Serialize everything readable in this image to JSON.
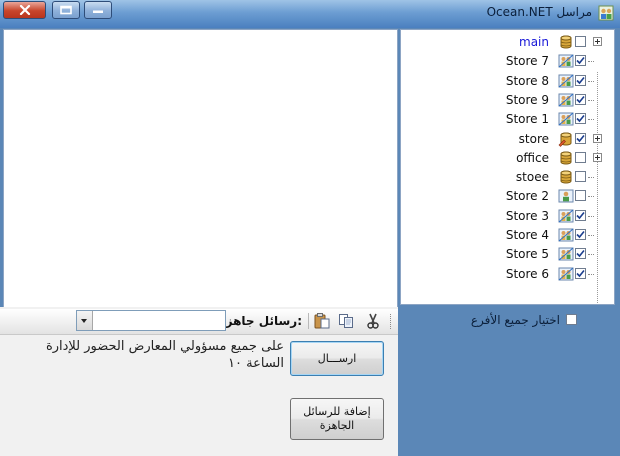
{
  "window": {
    "title": "Ocean.NET مراسل",
    "accent_color": "#5b87b7",
    "controls": [
      "close",
      "maximize",
      "minimize"
    ]
  },
  "tree": {
    "nodes": [
      {
        "label": "main",
        "icon": "database-icon",
        "checked": false,
        "expandable": true,
        "color": "#1a1ad8"
      },
      {
        "label": "Store 7",
        "icon": "user-group-icon",
        "checked": true,
        "expandable": false
      },
      {
        "label": "Store 8",
        "icon": "user-group-icon",
        "checked": true,
        "expandable": false
      },
      {
        "label": "Store 9",
        "icon": "user-group-icon",
        "checked": true,
        "expandable": false
      },
      {
        "label": "Store 1",
        "icon": "user-group-icon",
        "checked": true,
        "expandable": false
      },
      {
        "label": "store",
        "icon": "database-edit-icon",
        "checked": true,
        "expandable": true
      },
      {
        "label": "office",
        "icon": "database-icon",
        "checked": false,
        "expandable": true
      },
      {
        "label": "stoee",
        "icon": "database-icon",
        "checked": false,
        "expandable": false
      },
      {
        "label": "Store 2",
        "icon": "user-icon",
        "checked": false,
        "expandable": false
      },
      {
        "label": "Store 3",
        "icon": "user-group-icon",
        "checked": true,
        "expandable": false
      },
      {
        "label": "Store 4",
        "icon": "user-group-icon",
        "checked": true,
        "expandable": false
      },
      {
        "label": "Store 5",
        "icon": "user-group-icon",
        "checked": true,
        "expandable": false
      },
      {
        "label": "Store 6",
        "icon": "user-group-icon",
        "checked": true,
        "expandable": false
      }
    ]
  },
  "select_all": {
    "label": "اختيار جميع الأفرع",
    "checked": false
  },
  "toolbar": {
    "ready_messages_label": "رسائل جاهزة:",
    "ready_messages_value": "",
    "buttons": [
      "cut-icon",
      "copy-icon",
      "paste-icon"
    ]
  },
  "message": {
    "text": "على جميع مسؤولي المعارض الحضور للإدارة الساعة ١٠"
  },
  "buttons": {
    "send": "ارســـال",
    "add_to_ready": "إضافة للرسائل الجاهزة"
  }
}
